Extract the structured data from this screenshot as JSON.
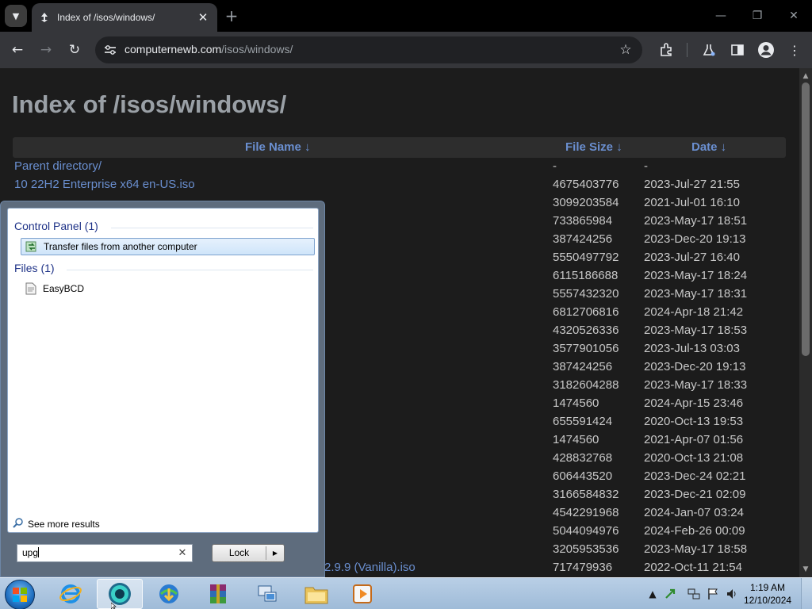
{
  "browser": {
    "tab_title": "Index of /isos/windows/",
    "tab_close": "✕",
    "new_tab": "+",
    "url_host": "computernewb.com",
    "url_path": "/isos/windows/",
    "window_controls": {
      "minimize": "—",
      "maximize": "❐",
      "close": "✕"
    }
  },
  "page": {
    "title": "Index of /isos/windows/",
    "columns": {
      "name": "File Name  ↓",
      "size": "File Size  ↓",
      "date": "Date  ↓"
    },
    "rows": [
      {
        "name": "Parent directory/",
        "size": "-",
        "date": "-"
      },
      {
        "name": "10 22H2 Enterprise x64 en-US.iso",
        "size": "4675403776",
        "date": "2023-Jul-27 21:55"
      },
      {
        "name": "",
        "size": "3099203584",
        "date": "2021-Jul-01 16:10"
      },
      {
        "name": "",
        "size": "733865984",
        "date": "2023-May-17 18:51"
      },
      {
        "name": "",
        "size": "387424256",
        "date": "2023-Dec-20 19:13"
      },
      {
        "name": "",
        "size": "5550497792",
        "date": "2023-Jul-27 16:40"
      },
      {
        "name": "",
        "size": "6115186688",
        "date": "2023-May-17 18:24"
      },
      {
        "name": "",
        "size": "5557432320",
        "date": "2023-May-17 18:31"
      },
      {
        "name": "",
        "size": "6812706816",
        "date": "2024-Apr-18 21:42"
      },
      {
        "name": "",
        "size": "4320526336",
        "date": "2023-May-17 18:53"
      },
      {
        "name": "",
        "size": "3577901056",
        "date": "2023-Jul-13 03:03"
      },
      {
        "name": "",
        "size": "387424256",
        "date": "2023-Dec-20 19:13"
      },
      {
        "name": "",
        "size": "3182604288",
        "date": "2023-May-17 18:33"
      },
      {
        "name": "",
        "size": "1474560",
        "date": "2024-Apr-15 23:46"
      },
      {
        "name": "",
        "size": "655591424",
        "date": "2020-Oct-13 19:53"
      },
      {
        "name": "",
        "size": "1474560",
        "date": "2021-Apr-07 01:56"
      },
      {
        "name": "",
        "size": "428832768",
        "date": "2020-Oct-13 21:08"
      },
      {
        "name": "",
        "size": "606443520",
        "date": "2023-Dec-24 02:21"
      },
      {
        "name": "",
        "size": "3166584832",
        "date": "2023-Dec-21 02:09"
      },
      {
        "name": "",
        "size": "4542291968",
        "date": "2024-Jan-07 03:24"
      },
      {
        "name": "",
        "size": "5044094976",
        "date": "2024-Feb-26 00:09"
      },
      {
        "name": "",
        "size": "3205953536",
        "date": "2023-May-17 18:58"
      },
      {
        "name": "2.9.9 (Vanilla).iso",
        "size": "717479936",
        "date": "2022-Oct-11 21:54"
      }
    ]
  },
  "startmenu": {
    "groups": [
      {
        "header": "Control Panel (1)",
        "items": [
          {
            "label": "Transfer files from another computer",
            "icon": "transfer-icon",
            "selected": true
          }
        ]
      },
      {
        "header": "Files (1)",
        "items": [
          {
            "label": "EasyBCD",
            "icon": "file-icon",
            "selected": false
          }
        ]
      }
    ],
    "see_more": "See more results",
    "search_value": "upg",
    "search_clear": "✕",
    "lock_label": "Lock",
    "lock_arrow": "▶"
  },
  "taskbar": {
    "apps": [
      "internet-explorer-icon",
      "chrome-icon",
      "download-manager-icon",
      "winrar-icon",
      "network-icon",
      "explorer-icon",
      "media-player-icon"
    ],
    "clock_time": "1:19 AM",
    "clock_date": "12/10/2024"
  },
  "colors": {
    "link": "#6a8fd0",
    "page_bg": "#1c1c1c",
    "header_bg": "#2d2d2d"
  }
}
